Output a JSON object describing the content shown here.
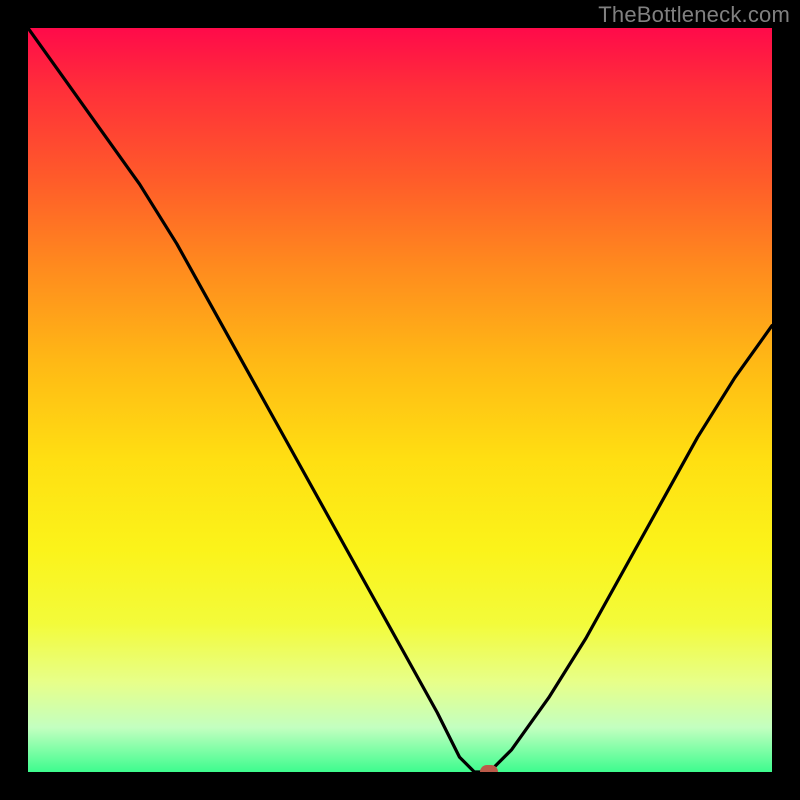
{
  "watermark": "TheBottleneck.com",
  "chart_data": {
    "type": "line",
    "title": "",
    "xlabel": "",
    "ylabel": "",
    "xlim": [
      0,
      100
    ],
    "ylim": [
      0,
      100
    ],
    "grid": false,
    "legend": false,
    "background_gradient": {
      "direction": "vertical",
      "stops": [
        {
          "pos": 0.0,
          "color": "#ff0a4a"
        },
        {
          "pos": 0.08,
          "color": "#ff2e3a"
        },
        {
          "pos": 0.2,
          "color": "#ff5a2a"
        },
        {
          "pos": 0.32,
          "color": "#ff8a1e"
        },
        {
          "pos": 0.45,
          "color": "#ffb915"
        },
        {
          "pos": 0.58,
          "color": "#ffdf12"
        },
        {
          "pos": 0.7,
          "color": "#fbf31a"
        },
        {
          "pos": 0.8,
          "color": "#f3fb3a"
        },
        {
          "pos": 0.88,
          "color": "#e7ff8a"
        },
        {
          "pos": 0.94,
          "color": "#c3ffc0"
        },
        {
          "pos": 1.0,
          "color": "#3dfc8e"
        }
      ]
    },
    "series": [
      {
        "name": "bottleneck-curve",
        "color": "#000000",
        "x": [
          0,
          5,
          10,
          15,
          20,
          25,
          30,
          35,
          40,
          45,
          50,
          55,
          58,
          60,
          62,
          65,
          70,
          75,
          80,
          85,
          90,
          95,
          100
        ],
        "y": [
          100,
          93,
          86,
          79,
          71,
          62,
          53,
          44,
          35,
          26,
          17,
          8,
          2,
          0,
          0,
          3,
          10,
          18,
          27,
          36,
          45,
          53,
          60
        ]
      }
    ],
    "marker": {
      "x": 62,
      "y": 0,
      "color": "#bb5a49"
    }
  }
}
